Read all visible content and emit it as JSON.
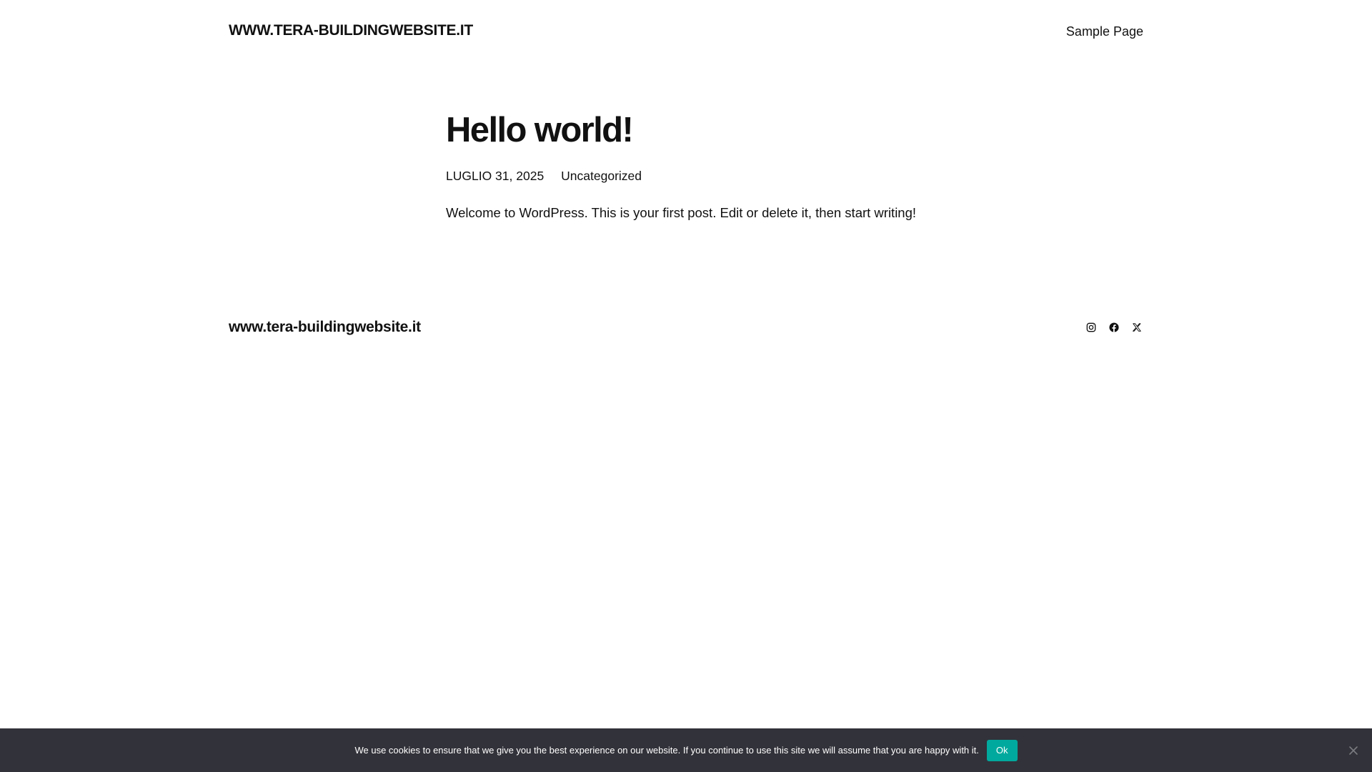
{
  "header": {
    "site_title": "WWW.TERA-BUILDINGWEBSITE.IT",
    "nav": [
      {
        "label": "Sample Page"
      }
    ]
  },
  "post": {
    "title": "Hello world!",
    "date": "LUGLIO 31, 2025",
    "category": "Uncategorized",
    "content": "Welcome to WordPress. This is your first post. Edit or delete it, then start writing!"
  },
  "footer": {
    "site_title": "www.tera-buildingwebsite.it",
    "social": [
      {
        "icon": "instagram-icon"
      },
      {
        "icon": "facebook-icon"
      },
      {
        "icon": "x-icon"
      }
    ]
  },
  "cookie_notice": {
    "text": "We use cookies to ensure that we give you the best experience on our website. If you continue to use this site we will assume that you are happy with it.",
    "ok_label": "Ok",
    "close_icon": "close-icon"
  },
  "colors": {
    "text": "#111111",
    "cookie_bar_bg": "#32323a",
    "cookie_button": "#00a99d"
  }
}
